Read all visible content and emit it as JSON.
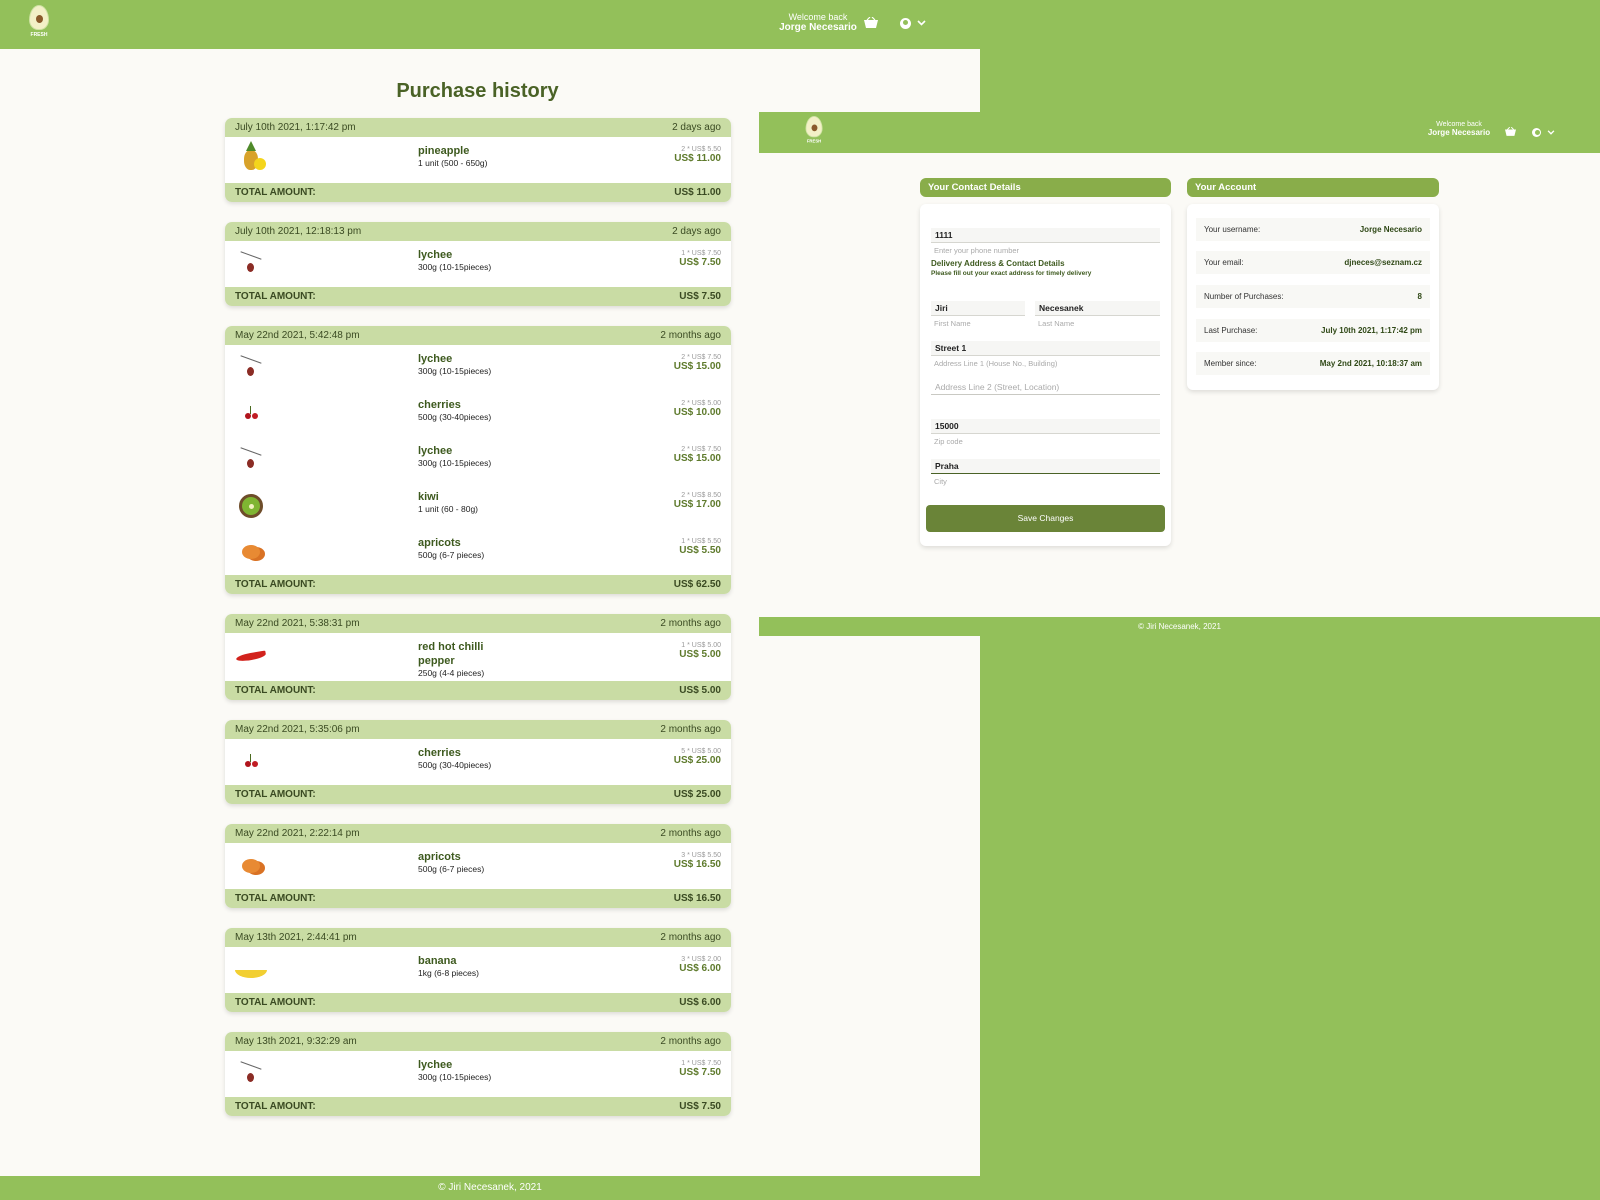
{
  "header": {
    "logo_text": "FRESH",
    "welcome": "Welcome back",
    "user_name": "Jorge Necesario"
  },
  "purchase_history": {
    "title": "Purchase history",
    "total_label": "TOTAL AMOUNT:",
    "orders": [
      {
        "date": "July 10th 2021, 1:17:42 pm",
        "ago": "2 days ago",
        "total": "US$ 11.00",
        "items": [
          {
            "name": "pineapple",
            "desc": "1 unit (500 - 650g)",
            "unit": "2 * US$ 5.50",
            "price": "US$ 11.00",
            "icon": "pineapple-icon"
          }
        ]
      },
      {
        "date": "July 10th 2021, 12:18:13 pm",
        "ago": "2 days ago",
        "total": "US$ 7.50",
        "items": [
          {
            "name": "lychee",
            "desc": "300g (10-15pieces)",
            "unit": "1 * US$ 7.50",
            "price": "US$ 7.50",
            "icon": "lychee-icon"
          }
        ]
      },
      {
        "date": "May 22nd 2021, 5:42:48 pm",
        "ago": "2 months ago",
        "total": "US$ 62.50",
        "items": [
          {
            "name": "lychee",
            "desc": "300g (10-15pieces)",
            "unit": "2 * US$ 7.50",
            "price": "US$ 15.00",
            "icon": "lychee-icon"
          },
          {
            "name": "cherries",
            "desc": "500g (30-40pieces)",
            "unit": "2 * US$ 5.00",
            "price": "US$ 10.00",
            "icon": "cherries-icon"
          },
          {
            "name": "lychee",
            "desc": "300g (10-15pieces)",
            "unit": "2 * US$ 7.50",
            "price": "US$ 15.00",
            "icon": "lychee-icon"
          },
          {
            "name": "kiwi",
            "desc": "1 unit (60 - 80g)",
            "unit": "2 * US$ 8.50",
            "price": "US$ 17.00",
            "icon": "kiwi-icon"
          },
          {
            "name": "apricots",
            "desc": "500g (6-7 pieces)",
            "unit": "1 * US$ 5.50",
            "price": "US$ 5.50",
            "icon": "apricots-icon"
          }
        ]
      },
      {
        "date": "May 22nd 2021, 5:38:31 pm",
        "ago": "2 months ago",
        "total": "US$ 5.00",
        "items": [
          {
            "name": "red hot chilli pepper",
            "desc": "250g (4-4 pieces)",
            "unit": "1 * US$ 5.00",
            "price": "US$ 5.00",
            "icon": "chilli-pepper-icon"
          }
        ]
      },
      {
        "date": "May 22nd 2021, 5:35:06 pm",
        "ago": "2 months ago",
        "total": "US$ 25.00",
        "items": [
          {
            "name": "cherries",
            "desc": "500g (30-40pieces)",
            "unit": "5 * US$ 5.00",
            "price": "US$ 25.00",
            "icon": "cherries-icon"
          }
        ]
      },
      {
        "date": "May 22nd 2021, 2:22:14 pm",
        "ago": "2 months ago",
        "total": "US$ 16.50",
        "items": [
          {
            "name": "apricots",
            "desc": "500g (6-7 pieces)",
            "unit": "3 * US$ 5.50",
            "price": "US$ 16.50",
            "icon": "apricots-icon"
          }
        ]
      },
      {
        "date": "May 13th 2021, 2:44:41 pm",
        "ago": "2 months ago",
        "total": "US$ 6.00",
        "items": [
          {
            "name": "banana",
            "desc": "1kg (6-8 pieces)",
            "unit": "3 * US$ 2.00",
            "price": "US$ 6.00",
            "icon": "banana-icon"
          }
        ]
      },
      {
        "date": "May 13th 2021, 9:32:29 am",
        "ago": "2 months ago",
        "total": "US$ 7.50",
        "items": [
          {
            "name": "lychee",
            "desc": "300g (10-15pieces)",
            "unit": "1 * US$ 7.50",
            "price": "US$ 7.50",
            "icon": "lychee-icon"
          }
        ]
      }
    ]
  },
  "footer": {
    "text": "© Jiri Necesanek, 2021"
  },
  "contact": {
    "title": "Your Contact Details",
    "phone_value": "1111",
    "phone_hint": "Enter your phone number",
    "delivery_title": "Delivery Address & Contact Details",
    "delivery_sub": "Please fill out your exact address for timely delivery",
    "first_name_value": "Jiri",
    "first_name_hint": "First Name",
    "last_name_value": "Necesanek",
    "last_name_hint": "Last Name",
    "address1_value": "Street 1",
    "address1_hint": "Address Line 1 (House No., Building)",
    "address2_placeholder": "Address Line 2 (Street, Location)",
    "zip_value": "15000",
    "zip_hint": "Zip code",
    "city_value": "Praha",
    "city_hint": "City",
    "save_label": "Save Changes"
  },
  "account": {
    "title": "Your Account",
    "rows": [
      {
        "label": "Your username:",
        "value": "Jorge Necesario"
      },
      {
        "label": "Your email:",
        "value": "djneces@seznam.cz"
      },
      {
        "label": "Number of Purchases:",
        "value": "8"
      },
      {
        "label": "Last Purchase:",
        "value": "July 10th 2021, 1:17:42 pm"
      },
      {
        "label": "Member since:",
        "value": "May 2nd 2021, 10:18:37 am"
      }
    ]
  },
  "colors": {
    "brand_green": "#93c05a",
    "dark_green": "#6a8438",
    "header_band": "#c9dca4"
  }
}
